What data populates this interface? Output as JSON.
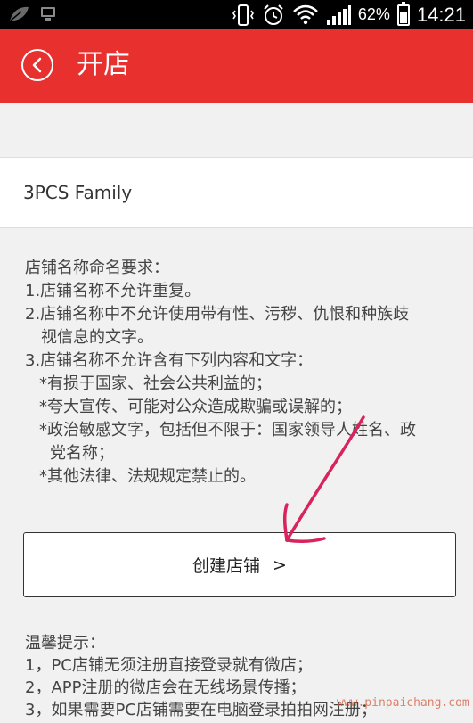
{
  "status_bar": {
    "battery": "62%",
    "time": "14:21",
    "battery_level": 0.62
  },
  "app_bar": {
    "title": "开店",
    "accent_color": "#e8302f"
  },
  "shop_name": {
    "value": "3PCS Family"
  },
  "rules": {
    "heading": "店铺名称命名要求：",
    "items": [
      "1.店铺名称不允许重复。",
      "2.店铺名称中不允许使用带有性、污秽、仇恨和种族歧",
      "视信息的文字。",
      "3.店铺名称不允许含有下列内容和文字：",
      "*有损于国家、社会公共利益的；",
      "*夸大宣传、可能对公众造成欺骗或误解的；",
      "*政治敏感文字，包括但不限于：国家领导人姓名、政",
      "党名称；",
      "*其他法律、法规规定禁止的。"
    ]
  },
  "create_button": {
    "label": "创建店铺",
    "chevron": ">"
  },
  "tips": {
    "heading": "温馨提示：",
    "items": [
      "1，PC店铺无须注册直接登录就有微店；",
      "2，APP注册的微店会在无线场景传播；",
      "3，如果需要PC店铺需要在电脑登录拍拍网注册；"
    ]
  },
  "watermark": "www.pinpaichang.com"
}
